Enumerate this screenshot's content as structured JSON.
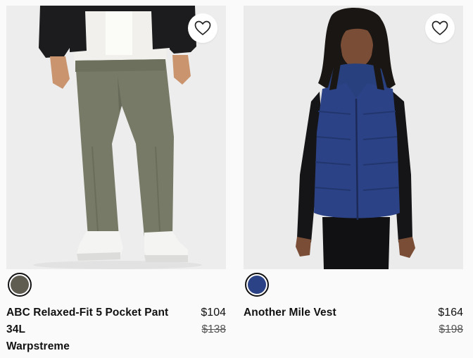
{
  "products": [
    {
      "name_lines": [
        "ABC Relaxed-Fit 5 Pocket Pant",
        "34L",
        "Warpstreme"
      ],
      "price": "$104",
      "original_price": "$138",
      "swatch_color": "#5f5d52",
      "favorite_icon": "heart-outline-icon"
    },
    {
      "name_lines": [
        "Another Mile Vest"
      ],
      "price": "$164",
      "original_price": "$198",
      "swatch_color": "#2c4286",
      "favorite_icon": "heart-outline-icon"
    }
  ],
  "colors": {
    "image_background": "#ededed",
    "page_background": "#fafafa",
    "text": "#111111",
    "strike_price": "#555555"
  }
}
